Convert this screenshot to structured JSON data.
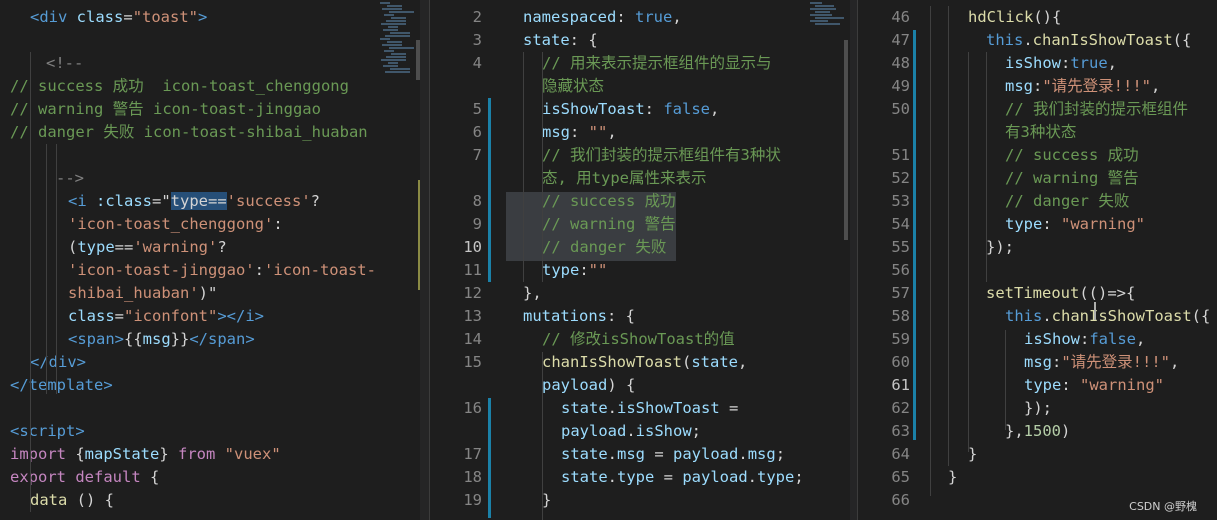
{
  "left": {
    "lines": [
      [
        [
          "t",
          "<div "
        ],
        [
          "v",
          "class"
        ],
        [
          "b",
          "="
        ],
        [
          "s",
          "\"toast\""
        ],
        [
          "t",
          ">"
        ]
      ],
      [],
      [
        [
          "g",
          "<!--"
        ]
      ],
      [
        [
          "c",
          "// success 成功  icon-toast_chenggong"
        ]
      ],
      [
        [
          "c",
          "// warning 警告 icon-toast-jinggao"
        ]
      ],
      [
        [
          "c",
          "// danger 失败 icon-toast-shibai_huaban"
        ]
      ],
      [],
      [
        [
          "g",
          "-->"
        ]
      ],
      [
        [
          "t",
          "<i "
        ],
        [
          "v",
          ":class"
        ],
        [
          "b",
          "=\""
        ],
        [
          "sel",
          "type=="
        ],
        [
          "s",
          "'success'"
        ],
        [
          "b",
          "?"
        ]
      ],
      [
        [
          "s",
          "'icon-toast_chenggong'"
        ],
        [
          "b",
          ":"
        ]
      ],
      [
        [
          "b",
          "("
        ],
        [
          "v",
          "type"
        ],
        [
          "b",
          "=="
        ],
        [
          "s",
          "'warning'"
        ],
        [
          "b",
          "?"
        ]
      ],
      [
        [
          "s",
          "'icon-toast-jinggao'"
        ],
        [
          "b",
          ":"
        ],
        [
          "s",
          "'icon-toast-"
        ]
      ],
      [
        [
          "s",
          "shibai_huaban'"
        ],
        [
          "b",
          ")\""
        ]
      ],
      [
        [
          "v",
          "class"
        ],
        [
          "b",
          "="
        ],
        [
          "s",
          "\"iconfont\""
        ],
        [
          "t",
          "></i>"
        ]
      ],
      [
        [
          "t",
          "<span>"
        ],
        [
          "b",
          "{{"
        ],
        [
          "v",
          "msg"
        ],
        [
          "b",
          "}}"
        ],
        [
          "t",
          "</span>"
        ]
      ],
      [
        [
          "t",
          "</div>"
        ]
      ],
      [
        [
          "t",
          "</template>"
        ]
      ],
      [],
      [
        [
          "t",
          "<script>"
        ]
      ],
      [
        [
          "ctl",
          "import "
        ],
        [
          "b",
          "{"
        ],
        [
          "v",
          "mapState"
        ],
        [
          "b",
          "} "
        ],
        [
          "ctl",
          "from "
        ],
        [
          "s",
          "\"vuex\""
        ]
      ],
      [
        [
          "ctl",
          "export default "
        ],
        [
          "b",
          "{"
        ]
      ],
      [
        [
          "f",
          "data "
        ],
        [
          "b",
          "() {"
        ]
      ]
    ]
  },
  "middle": {
    "lines": [
      {
        "n": "2",
        "parts": [
          [
            "v",
            "namespaced"
          ],
          [
            "b",
            ": "
          ],
          [
            "k",
            "true"
          ],
          [
            "b",
            ","
          ]
        ]
      },
      {
        "n": "3",
        "parts": [
          [
            "v",
            "state"
          ],
          [
            "b",
            ": {"
          ]
        ]
      },
      {
        "n": "4",
        "parts": [
          [
            "c",
            "// 用来表示提示框组件的显示与"
          ]
        ]
      },
      {
        "n": "",
        "parts": [
          [
            "c",
            "隐藏状态"
          ]
        ]
      },
      {
        "n": "5",
        "parts": [
          [
            "v",
            "isShowToast"
          ],
          [
            "b",
            ": "
          ],
          [
            "k",
            "false"
          ],
          [
            "b",
            ","
          ]
        ]
      },
      {
        "n": "6",
        "parts": [
          [
            "v",
            "msg"
          ],
          [
            "b",
            ": "
          ],
          [
            "s",
            "\"\""
          ],
          [
            "b",
            ","
          ]
        ]
      },
      {
        "n": "7",
        "parts": [
          [
            "c",
            "// 我们封装的提示框组件有3种状"
          ]
        ]
      },
      {
        "n": "",
        "parts": [
          [
            "c",
            "态, 用type属性来表示"
          ]
        ]
      },
      {
        "n": "8",
        "parts": [
          [
            "c",
            "// success 成功"
          ]
        ]
      },
      {
        "n": "9",
        "parts": [
          [
            "c",
            "// warning 警告"
          ]
        ]
      },
      {
        "n": "10",
        "parts": [
          [
            "c",
            "// danger 失败"
          ]
        ]
      },
      {
        "n": "11",
        "parts": [
          [
            "v",
            "type"
          ],
          [
            "b",
            ":"
          ],
          [
            "s",
            "\"\""
          ]
        ]
      },
      {
        "n": "12",
        "parts": [
          [
            "b",
            "},"
          ]
        ]
      },
      {
        "n": "13",
        "parts": [
          [
            "v",
            "mutations"
          ],
          [
            "b",
            ": {"
          ]
        ]
      },
      {
        "n": "14",
        "parts": [
          [
            "c",
            "// 修改isShowToast的值"
          ]
        ]
      },
      {
        "n": "15",
        "parts": [
          [
            "f",
            "chanIsShowToast"
          ],
          [
            "b",
            "("
          ],
          [
            "v",
            "state"
          ],
          [
            "b",
            ","
          ]
        ]
      },
      {
        "n": "",
        "parts": [
          [
            "v",
            "payload"
          ],
          [
            "b",
            ") {"
          ]
        ]
      },
      {
        "n": "16",
        "parts": [
          [
            "v",
            "state"
          ],
          [
            "b",
            "."
          ],
          [
            "v",
            "isShowToast"
          ],
          [
            "b",
            " ="
          ]
        ]
      },
      {
        "n": "",
        "parts": [
          [
            "v",
            "payload"
          ],
          [
            "b",
            "."
          ],
          [
            "v",
            "isShow"
          ],
          [
            "b",
            ";"
          ]
        ]
      },
      {
        "n": "17",
        "parts": [
          [
            "v",
            "state"
          ],
          [
            "b",
            "."
          ],
          [
            "v",
            "msg"
          ],
          [
            "b",
            " = "
          ],
          [
            "v",
            "payload"
          ],
          [
            "b",
            "."
          ],
          [
            "v",
            "msg"
          ],
          [
            "b",
            ";"
          ]
        ]
      },
      {
        "n": "18",
        "parts": [
          [
            "v",
            "state"
          ],
          [
            "b",
            "."
          ],
          [
            "v",
            "type"
          ],
          [
            "b",
            " = "
          ],
          [
            "v",
            "payload"
          ],
          [
            "b",
            "."
          ],
          [
            "v",
            "type"
          ],
          [
            "b",
            ";"
          ]
        ]
      },
      {
        "n": "19",
        "parts": [
          [
            "b",
            "}"
          ]
        ]
      }
    ]
  },
  "right": {
    "lines": [
      {
        "n": "46",
        "parts": [
          [
            "f",
            "hdClick"
          ],
          [
            "b",
            "(){"
          ]
        ]
      },
      {
        "n": "47",
        "parts": [
          [
            "k",
            "this"
          ],
          [
            "b",
            "."
          ],
          [
            "f",
            "chanIsShowToast"
          ],
          [
            "b",
            "({"
          ]
        ]
      },
      {
        "n": "48",
        "parts": [
          [
            "v",
            "isShow"
          ],
          [
            "b",
            ":"
          ],
          [
            "k",
            "true"
          ],
          [
            "b",
            ","
          ]
        ]
      },
      {
        "n": "49",
        "parts": [
          [
            "v",
            "msg"
          ],
          [
            "b",
            ":"
          ],
          [
            "s",
            "\"请先登录!!!\""
          ],
          [
            "b",
            ","
          ]
        ]
      },
      {
        "n": "50",
        "parts": [
          [
            "c",
            "// 我们封装的提示框组件"
          ]
        ]
      },
      {
        "n": "",
        "parts": [
          [
            "c",
            "有3种状态"
          ]
        ]
      },
      {
        "n": "51",
        "parts": [
          [
            "c",
            "// success 成功"
          ]
        ]
      },
      {
        "n": "52",
        "parts": [
          [
            "c",
            "// warning 警告"
          ]
        ]
      },
      {
        "n": "53",
        "parts": [
          [
            "c",
            "// danger 失败"
          ]
        ]
      },
      {
        "n": "54",
        "parts": [
          [
            "v",
            "type"
          ],
          [
            "b",
            ": "
          ],
          [
            "s",
            "\"warning\""
          ]
        ]
      },
      {
        "n": "55",
        "parts": [
          [
            "b",
            "});"
          ]
        ]
      },
      {
        "n": "56",
        "parts": []
      },
      {
        "n": "57",
        "parts": [
          [
            "f",
            "setTimeout"
          ],
          [
            "b",
            "(()=>{"
          ]
        ]
      },
      {
        "n": "58",
        "parts": [
          [
            "k",
            "this"
          ],
          [
            "b",
            "."
          ],
          [
            "f",
            "chanIsShowToast"
          ],
          [
            "b",
            "({"
          ]
        ]
      },
      {
        "n": "59",
        "parts": [
          [
            "v",
            "isShow"
          ],
          [
            "b",
            ":"
          ],
          [
            "k",
            "false"
          ],
          [
            "b",
            ","
          ]
        ]
      },
      {
        "n": "60",
        "parts": [
          [
            "v",
            "msg"
          ],
          [
            "b",
            ":"
          ],
          [
            "s",
            "\"请先登录!!!\""
          ],
          [
            "b",
            ","
          ]
        ]
      },
      {
        "n": "61",
        "parts": [
          [
            "v",
            "type"
          ],
          [
            "b",
            ": "
          ],
          [
            "s",
            "\"warning\""
          ]
        ]
      },
      {
        "n": "62",
        "parts": [
          [
            "b",
            "});"
          ]
        ]
      },
      {
        "n": "63",
        "parts": [
          [
            "b",
            "},"
          ],
          [
            "n",
            "1500"
          ],
          [
            "b",
            ")"
          ]
        ]
      },
      {
        "n": "64",
        "parts": [
          [
            "b",
            "}"
          ]
        ]
      },
      {
        "n": "65",
        "parts": [
          [
            "b",
            "}"
          ]
        ]
      },
      {
        "n": "66",
        "parts": []
      }
    ]
  },
  "watermark": "CSDN @野槐",
  "colors": {
    "background": "#1e1e1e",
    "keyword": "#569cd6",
    "string": "#ce9178",
    "comment": "#6a9955",
    "variable": "#9cdcfe"
  }
}
